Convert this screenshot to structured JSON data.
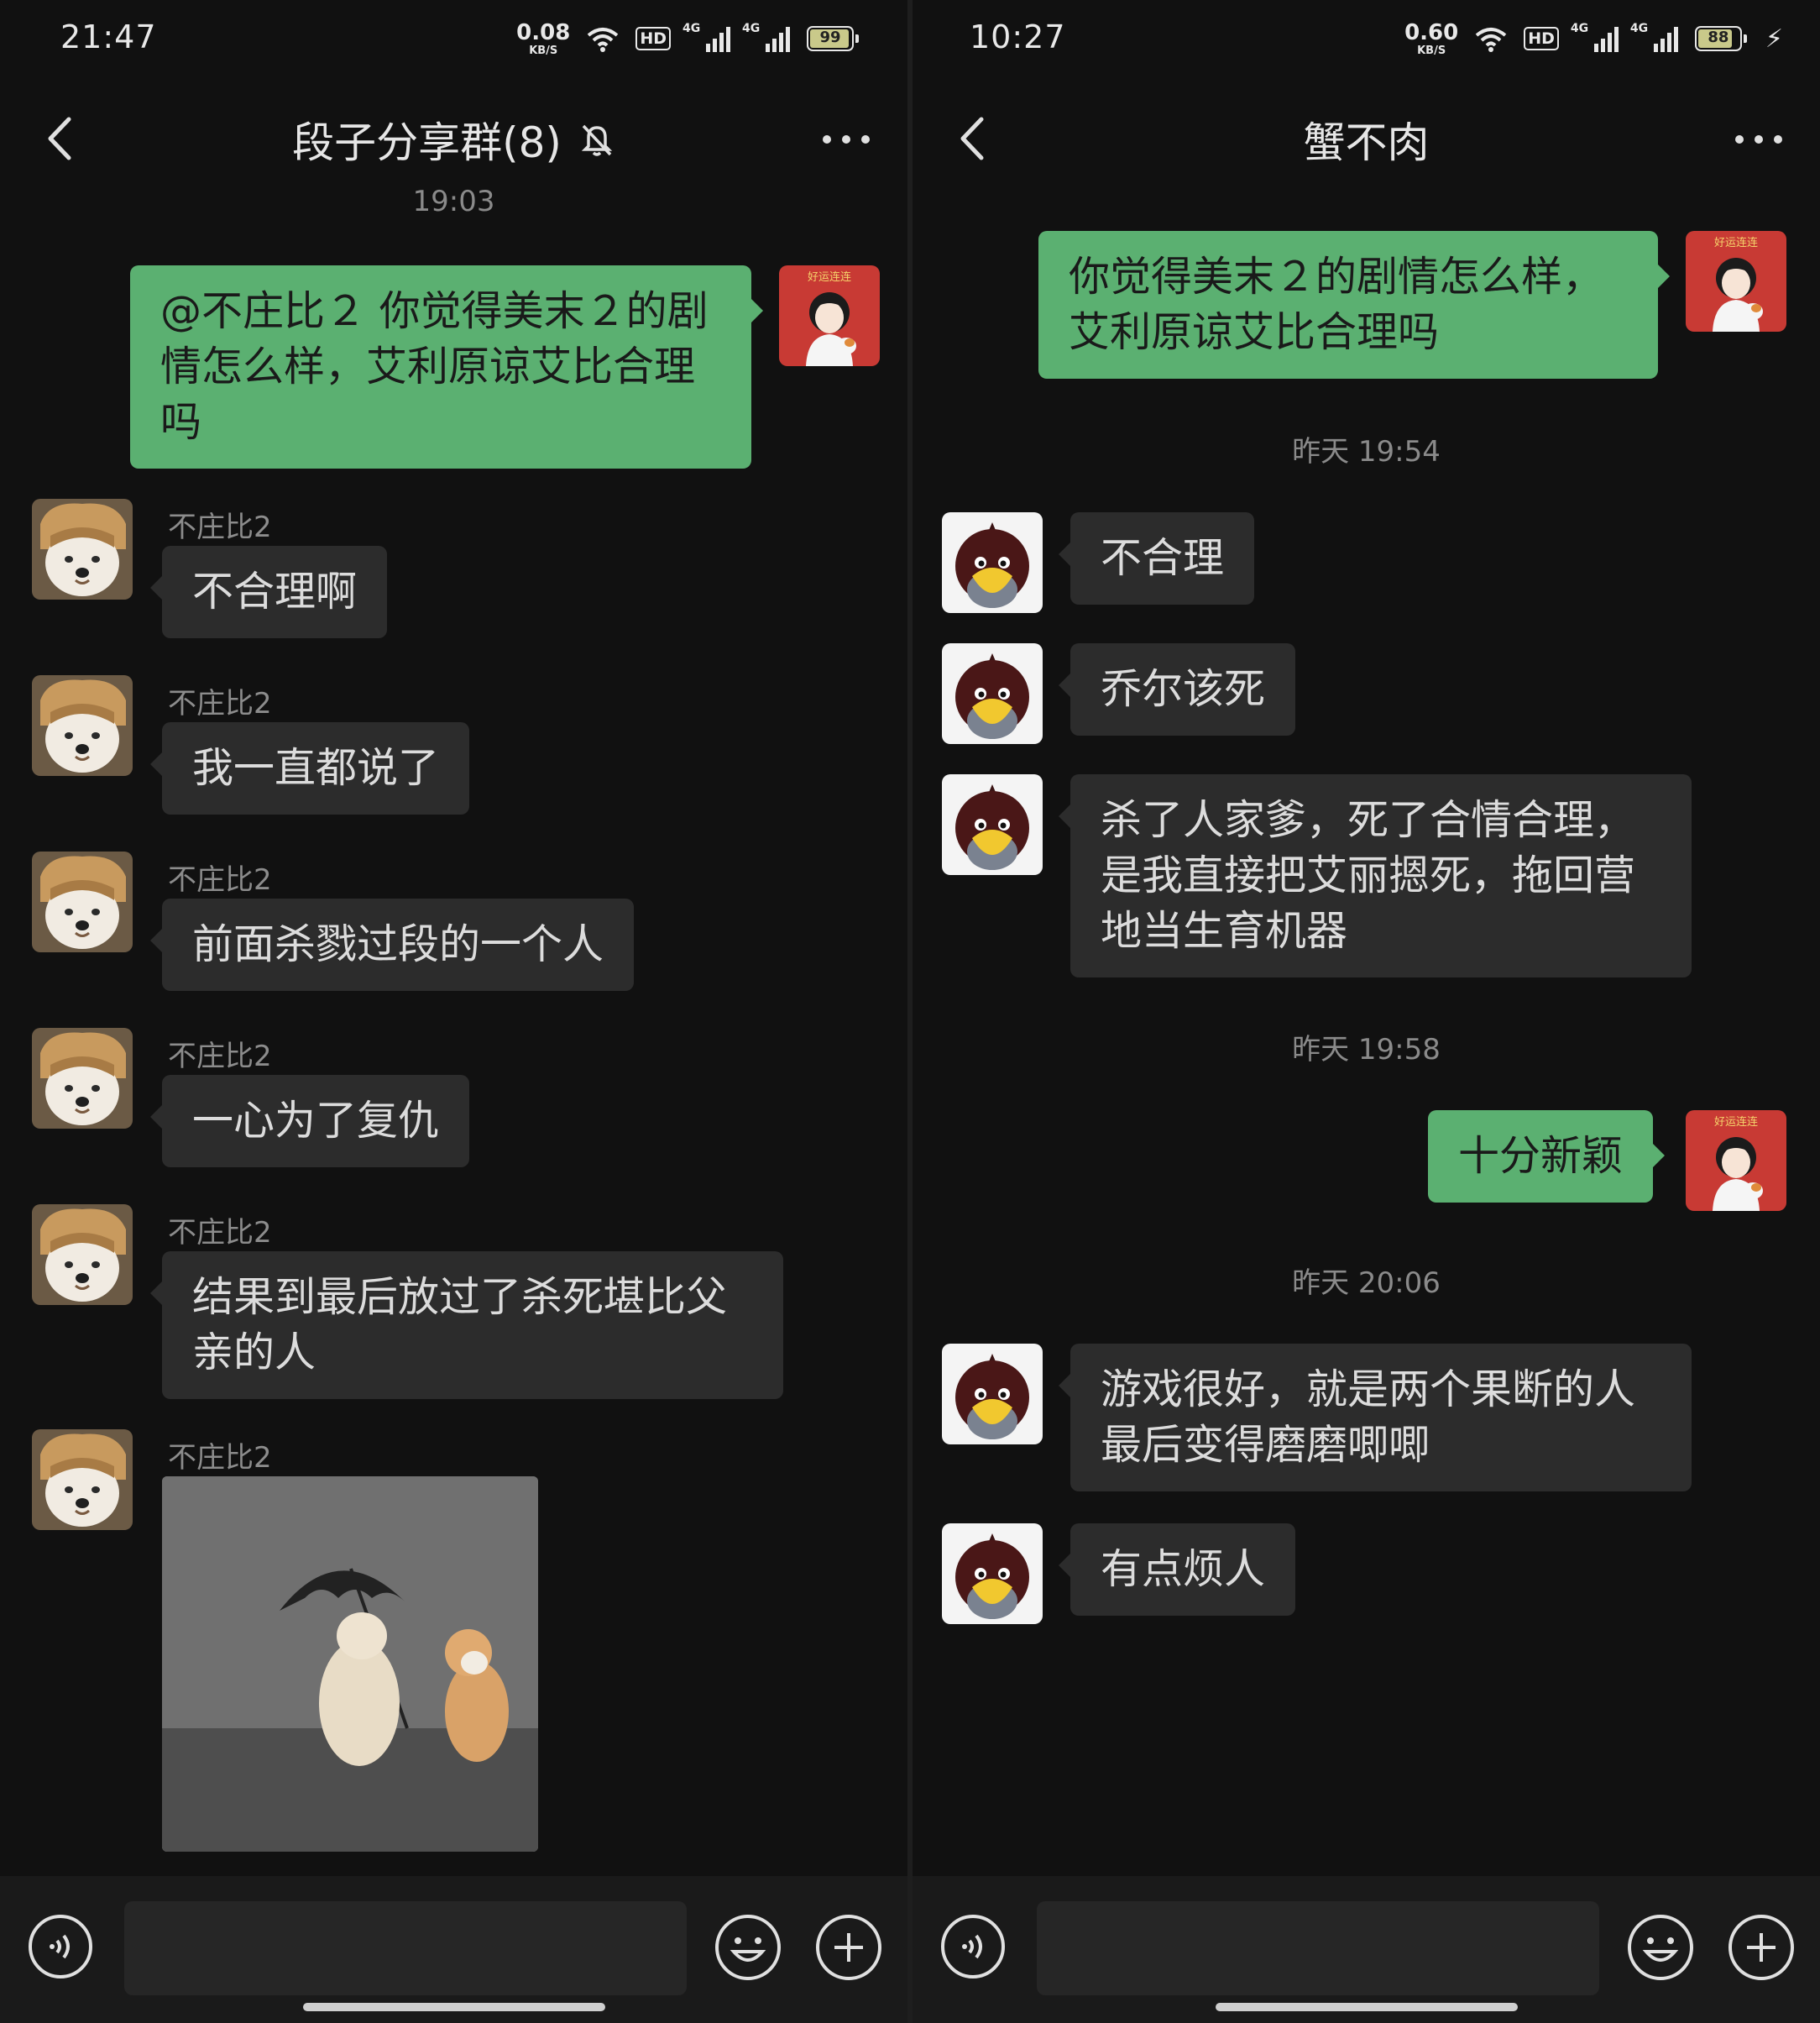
{
  "left": {
    "status": {
      "time": "21:47",
      "speed": "0.08",
      "speed_unit": "KB/S",
      "hd": "HD",
      "net1": "4G",
      "net2": "4G",
      "battery": "99"
    },
    "title": "段子分享群(8)",
    "timestamp": "19:03",
    "outgoing": "@不庄比２ 你觉得美末２的剧情怎么样，艾利原谅艾比合理吗",
    "sender_name": "不庄比2",
    "messages": [
      "不合理啊",
      "我一直都说了",
      "前面杀戮过段的一个人",
      "一心为了复仇",
      "结果到最后放过了杀死堪比父亲的人"
    ]
  },
  "right": {
    "status": {
      "time": "10:27",
      "speed": "0.60",
      "speed_unit": "KB/S",
      "hd": "HD",
      "net1": "4G",
      "net2": "4G",
      "battery": "88"
    },
    "title": "蟹不肉",
    "outgoing1": "你觉得美末２的剧情怎么样，艾利原谅艾比合理吗",
    "ts1": "昨天 19:54",
    "in1": "不合理",
    "in2": "乔尔该死",
    "in3": "杀了人家爹，死了合情合理，是我直接把艾丽摁死，拖回营地当生育机器",
    "ts2": "昨天 19:58",
    "outgoing2": "十分新颖",
    "ts3": "昨天 20:06",
    "in4": "游戏很好，就是两个果断的人最后变得磨磨唧唧",
    "in5": "有点烦人"
  },
  "avatar_sticker_text": "好运连连",
  "colors": {
    "outgoing_bubble": "#5bb071",
    "incoming_bubble": "#2c2c2c",
    "background": "#111111"
  },
  "icons": [
    "back-arrow-icon",
    "mute-bell-icon",
    "more-icon",
    "voice-icon",
    "emoji-icon",
    "plus-icon"
  ]
}
